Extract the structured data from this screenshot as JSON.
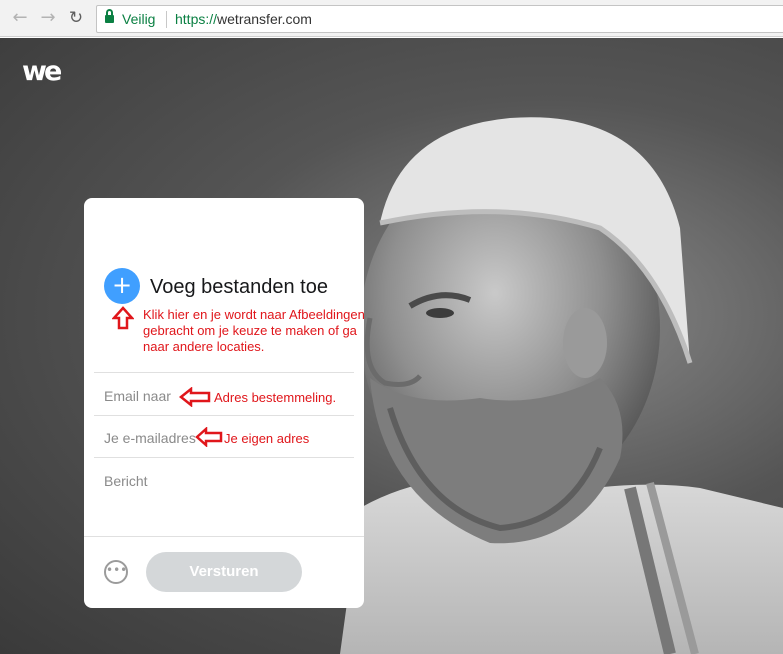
{
  "browser": {
    "nav": {
      "back_icon": "←",
      "forward_icon": "→",
      "reload_icon": "↻"
    },
    "secure_label": "Veilig",
    "url_scheme": "https://",
    "url_host": "wetransfer.com"
  },
  "site": {
    "logo_text": "we"
  },
  "card": {
    "add_icon": "+",
    "add_title": "Voeg bestanden toe",
    "email_to_placeholder": "Email naar",
    "your_email_placeholder": "Je e-mailadres",
    "message_placeholder": "Bericht",
    "more_icon": "•••",
    "send_label": "Versturen"
  },
  "annotations": {
    "upload_note": "Klik hier en je wordt naar Afbeeldingen gebracht om je keuze te maken of ga naar andere locaties.",
    "recipient_note": "Adres bestemmeling.",
    "own_address_note": "Je eigen adres"
  },
  "colors": {
    "accent_blue": "#409fff",
    "annotation_red": "#e0161b",
    "secure_green": "#0b8043",
    "send_disabled": "#d4d7d9"
  }
}
